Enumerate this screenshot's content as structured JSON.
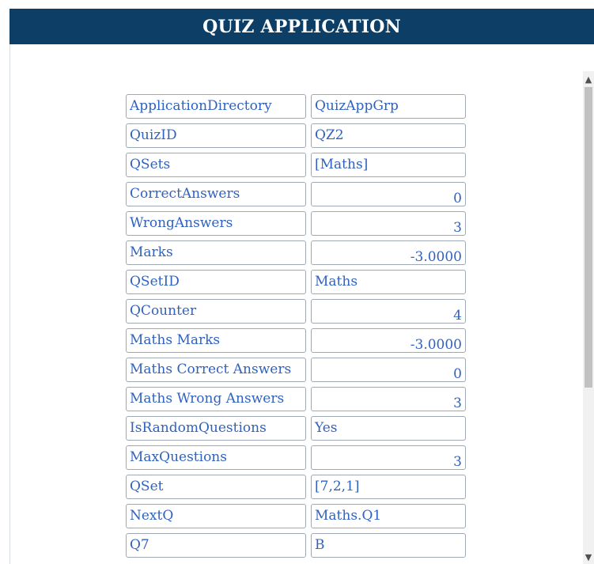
{
  "app": {
    "title": "QUIZ APPLICATION"
  },
  "variables": [
    {
      "key": "ApplicationDirectory",
      "value": "QuizAppGrp",
      "numeric": false
    },
    {
      "key": "QuizID",
      "value": "QZ2",
      "numeric": false
    },
    {
      "key": "QSets",
      "value": "[Maths]",
      "numeric": false
    },
    {
      "key": "CorrectAnswers",
      "value": "0",
      "numeric": true
    },
    {
      "key": "WrongAnswers",
      "value": "3",
      "numeric": true
    },
    {
      "key": "Marks",
      "value": "-3.0000",
      "numeric": true
    },
    {
      "key": "QSetID",
      "value": "Maths",
      "numeric": false
    },
    {
      "key": "QCounter",
      "value": "4",
      "numeric": true
    },
    {
      "key": "Maths Marks",
      "value": "-3.0000",
      "numeric": true
    },
    {
      "key": "Maths Correct Answers",
      "value": "0",
      "numeric": true
    },
    {
      "key": "Maths Wrong Answers",
      "value": "3",
      "numeric": true
    },
    {
      "key": "IsRandomQuestions",
      "value": "Yes",
      "numeric": false
    },
    {
      "key": "MaxQuestions",
      "value": "3",
      "numeric": true
    },
    {
      "key": "QSet",
      "value": "[7,2,1]",
      "numeric": false
    },
    {
      "key": "NextQ",
      "value": "Maths.Q1",
      "numeric": false
    },
    {
      "key": "Q7",
      "value": "B",
      "numeric": false
    }
  ],
  "scrollbar": {
    "up_icon": "chevron-up-icon",
    "down_icon": "chevron-down-icon"
  }
}
